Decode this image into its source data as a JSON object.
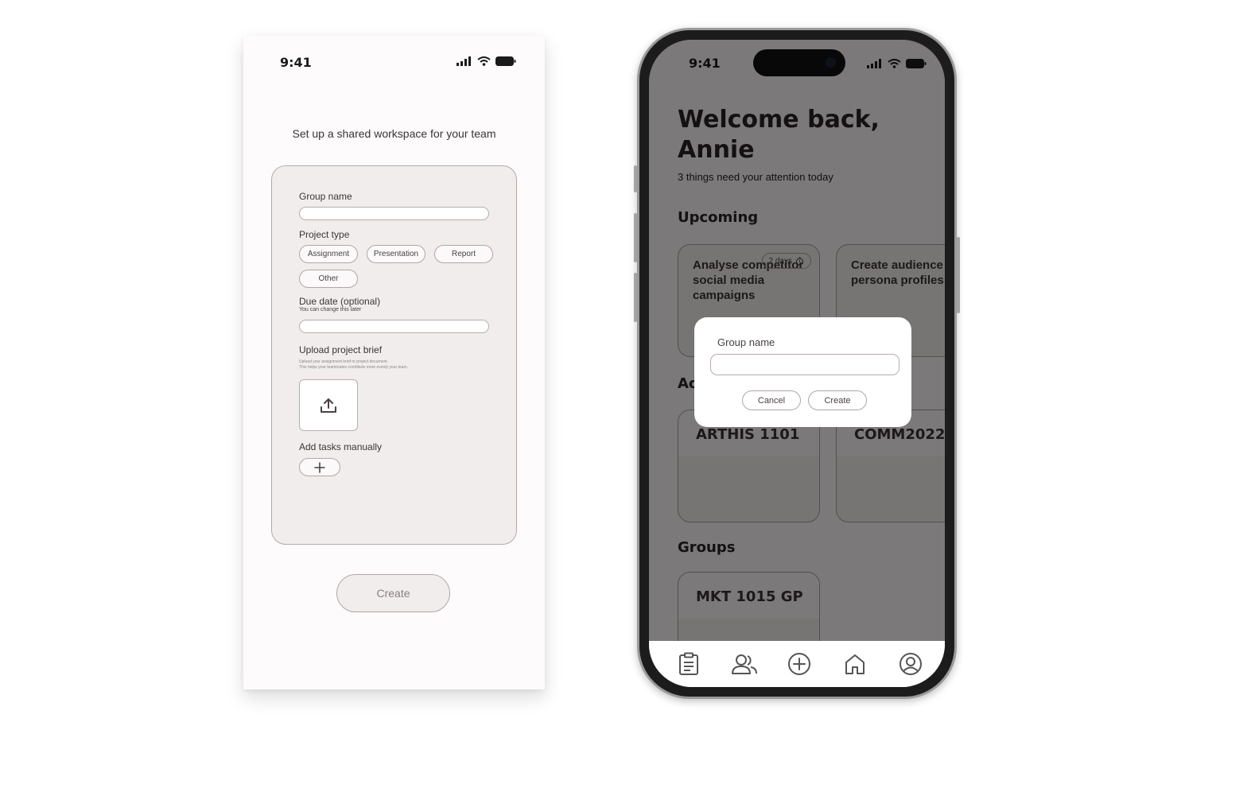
{
  "left_screen": {
    "status_time": "9:41",
    "title": "Set up a shared workspace for your team",
    "form": {
      "group_name_label": "Group name",
      "project_type_label": "Project type",
      "project_types": [
        "Assignment",
        "Presentation",
        "Report",
        "Other"
      ],
      "due_date_label": "Due date (optional)",
      "due_date_hint": "You can change this later",
      "upload_label": "Upload project brief",
      "upload_hint_1": "Upload your assignment brief or project document.",
      "upload_hint_2": "This helps your teammates contribute more evenly your team.",
      "add_tasks_label": "Add tasks manually"
    },
    "create_label": "Create"
  },
  "right_screen": {
    "status_time": "9:41",
    "welcome": "Welcome back, Annie",
    "attention": "3 things need your attention today",
    "upcoming_title": "Upcoming",
    "upcoming_cards": [
      {
        "title": "Analyse competitor social media campaigns",
        "badge": "2 days"
      },
      {
        "title": "Create audience persona profiles"
      }
    ],
    "active_title": "Ac",
    "course_cards": [
      "ARTHIS 1101",
      "COMM2022"
    ],
    "groups_title": "Groups",
    "group_cards": [
      "MKT 1015 GP"
    ],
    "modal": {
      "label": "Group name",
      "cancel": "Cancel",
      "create": "Create"
    },
    "tabs": [
      "tasks-icon",
      "groups-icon",
      "add-icon",
      "home-icon",
      "profile-icon"
    ]
  },
  "colors": {
    "accent_border": "#b2a5a7",
    "card_bg": "#f1eded",
    "text": "#3f3537"
  }
}
